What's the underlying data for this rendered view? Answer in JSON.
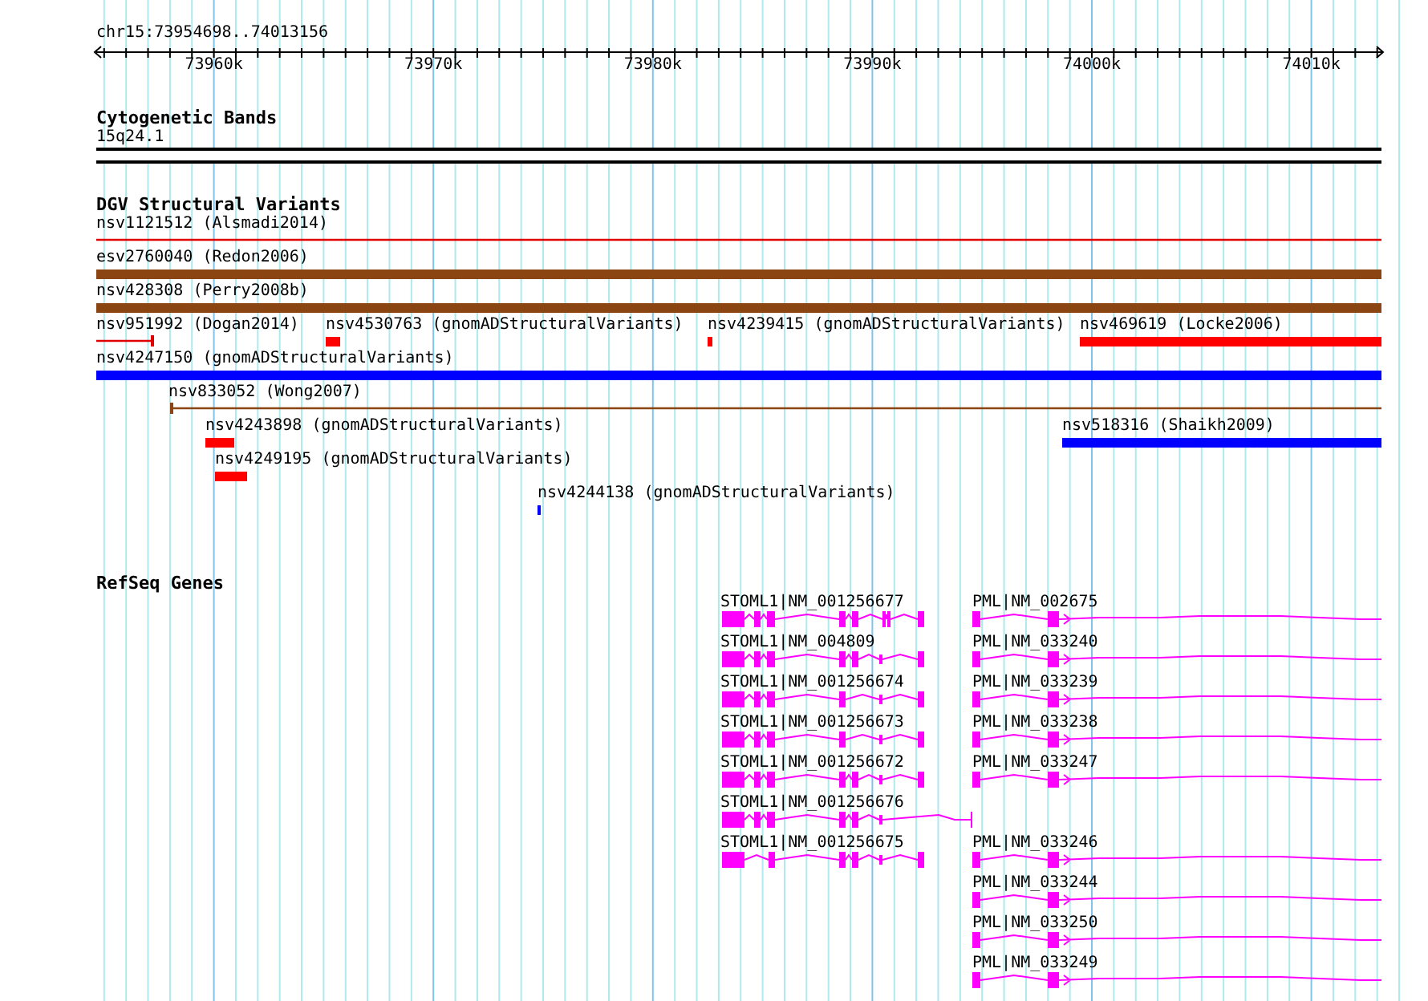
{
  "ruler": {
    "location": "chr15:73954698..74013156",
    "ticks": [
      "73960k",
      "73970k",
      "73980k",
      "73990k",
      "74000k",
      "74010k"
    ]
  },
  "tracks": [
    {
      "title": "Cytogenetic Bands",
      "kind": "bands",
      "features": [
        {
          "label": "15q24.1"
        }
      ]
    },
    {
      "title": "DGV Structural Variants",
      "kind": "variants",
      "features": [
        {
          "label": "nsv1121512 (Alsmadi2014)",
          "color": "#e00000",
          "kind": "thin"
        },
        {
          "label": "esv2760040 (Redon2006)",
          "color": "#8b4513",
          "kind": "thick"
        },
        {
          "label": "nsv428308 (Perry2008b)",
          "color": "#8b4513",
          "kind": "thick"
        },
        {
          "label": "nsv951992 (Dogan2014)",
          "color": "#e00000",
          "kind": "thin"
        },
        {
          "label": "nsv4530763 (gnomADStructuralVariants)",
          "color": "#ff0000",
          "kind": "thick"
        },
        {
          "label": "nsv4239415 (gnomADStructuralVariants)",
          "color": "#ff0000",
          "kind": "thick"
        },
        {
          "label": "nsv469619 (Locke2006)",
          "color": "#ff0000",
          "kind": "thick"
        },
        {
          "label": "nsv4247150 (gnomADStructuralVariants)",
          "color": "#0000ff",
          "kind": "thick"
        },
        {
          "label": "nsv833052 (Wong2007)",
          "color": "#8b4513",
          "kind": "thin"
        },
        {
          "label": "nsv4243898 (gnomADStructuralVariants)",
          "color": "#ff0000",
          "kind": "thick"
        },
        {
          "label": "nsv518316 (Shaikh2009)",
          "color": "#0000ff",
          "kind": "thick"
        },
        {
          "label": "nsv4249195 (gnomADStructuralVariants)",
          "color": "#ff0000",
          "kind": "thick"
        },
        {
          "label": "nsv4244138 (gnomADStructuralVariants)",
          "color": "#0000ff",
          "kind": "thick"
        }
      ]
    },
    {
      "title": "RefSeq Genes",
      "kind": "genes",
      "features": [
        {
          "label": "STOML1|NM_001256677"
        },
        {
          "label": "STOML1|NM_004809"
        },
        {
          "label": "STOML1|NM_001256674"
        },
        {
          "label": "STOML1|NM_001256673"
        },
        {
          "label": "STOML1|NM_001256672"
        },
        {
          "label": "STOML1|NM_001256676"
        },
        {
          "label": "STOML1|NM_001256675"
        },
        {
          "label": "PML|NM_002675"
        },
        {
          "label": "PML|NM_033240"
        },
        {
          "label": "PML|NM_033239"
        },
        {
          "label": "PML|NM_033238"
        },
        {
          "label": "PML|NM_033247"
        },
        {
          "label": "PML|NM_033246"
        },
        {
          "label": "PML|NM_033244"
        },
        {
          "label": "PML|NM_033250"
        },
        {
          "label": "PML|NM_033249"
        }
      ]
    }
  ]
}
